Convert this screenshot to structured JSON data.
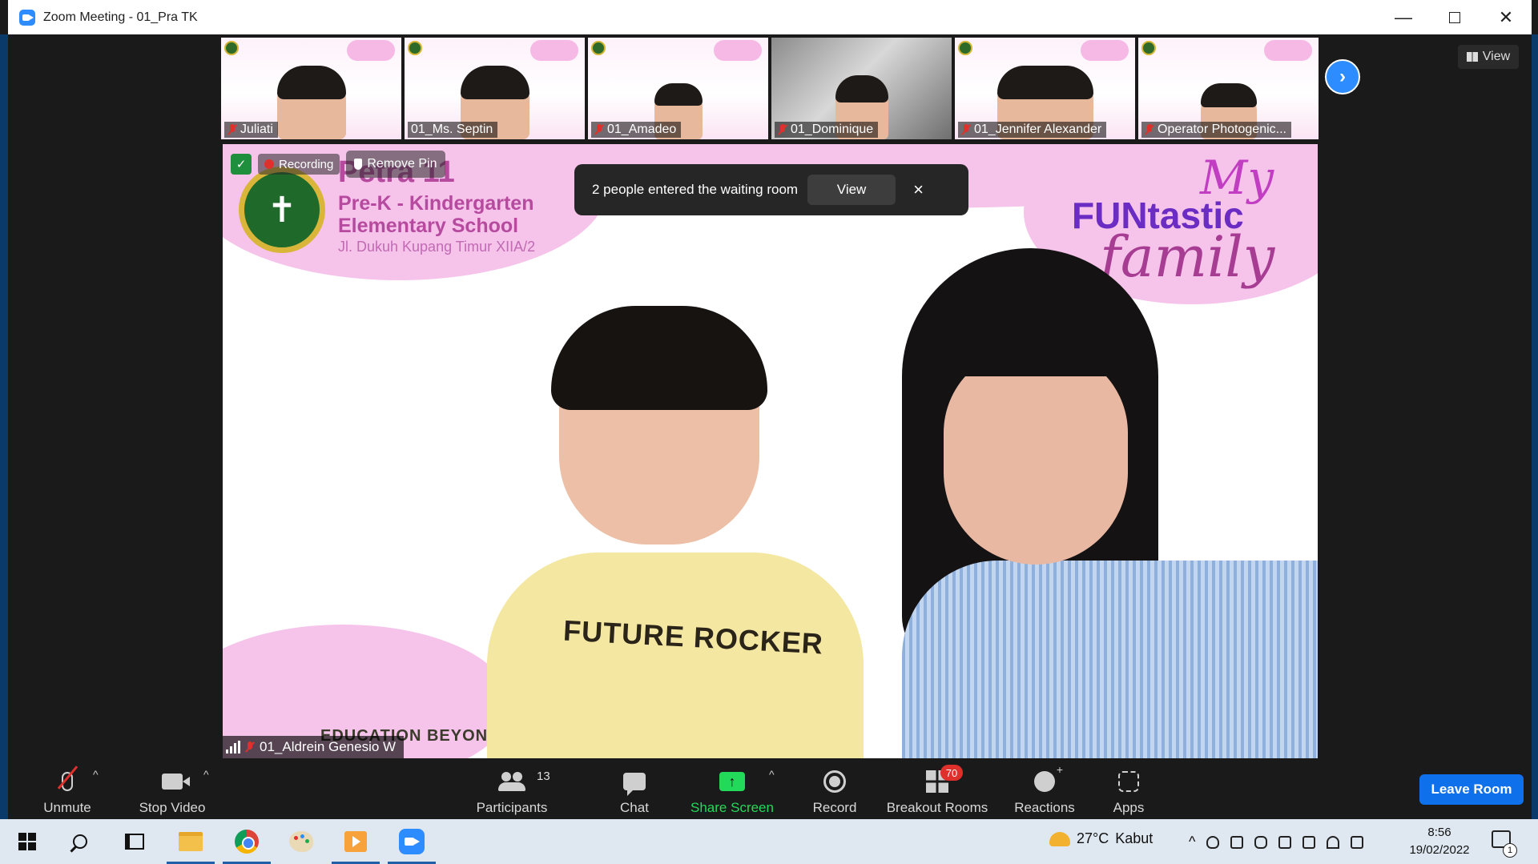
{
  "window": {
    "title": "Zoom Meeting - 01_Pra TK",
    "minimize_glyph": "—",
    "close_glyph": "✕"
  },
  "thumbnails": [
    {
      "name": "Juliati",
      "muted": true
    },
    {
      "name": "01_Ms. Septin",
      "muted": false
    },
    {
      "name": "01_Amadeo",
      "muted": true
    },
    {
      "name": "01_Dominique",
      "muted": true
    },
    {
      "name": "01_Jennifer Alexander",
      "muted": true
    },
    {
      "name": "Operator Photogenic...",
      "muted": true
    }
  ],
  "gallery": {
    "next_icon": "chevron-right-icon",
    "next_glyph": "›",
    "view_label": "View"
  },
  "main_video": {
    "recording_label": "Recording",
    "remove_pin_label": "Remove Pin",
    "participant_name": "01_Aldrein Genesio W",
    "background": {
      "school_name": "Petra 11",
      "school_line1": "Pre-K  - Kindergarten",
      "school_line2": "Elementary School",
      "school_address": "Jl. Dukuh Kupang Timur XIIA/2",
      "brand_my": "My",
      "brand_fun": "FUNtastic",
      "brand_family": "family",
      "footer_text": "EDUCATION BEYON",
      "shirt_text": "FUTURE ROCKER"
    }
  },
  "toast": {
    "message": "2 people entered the waiting room",
    "view_label": "View",
    "close_glyph": "×"
  },
  "toolbar": {
    "unmute_label": "Unmute",
    "stop_video_label": "Stop Video",
    "participants_label": "Participants",
    "participants_count": "13",
    "chat_label": "Chat",
    "share_screen_label": "Share Screen",
    "record_label": "Record",
    "breakout_rooms_label": "Breakout Rooms",
    "breakout_rooms_badge": "70",
    "reactions_label": "Reactions",
    "apps_label": "Apps",
    "leave_label": "Leave Room",
    "caret_glyph": "^",
    "share_glyph": "↑"
  },
  "taskbar": {
    "weather_temp": "27°C",
    "weather_desc": "Kabut",
    "tray_caret": "^",
    "time": "8:56",
    "date": "19/02/2022",
    "notification_count": "1"
  },
  "colors": {
    "zoom_blue": "#2d8cff",
    "leave_blue": "#0e71eb",
    "share_green": "#23d959",
    "muted_red": "#e0302b",
    "background_pink": "#f6c3ea"
  }
}
